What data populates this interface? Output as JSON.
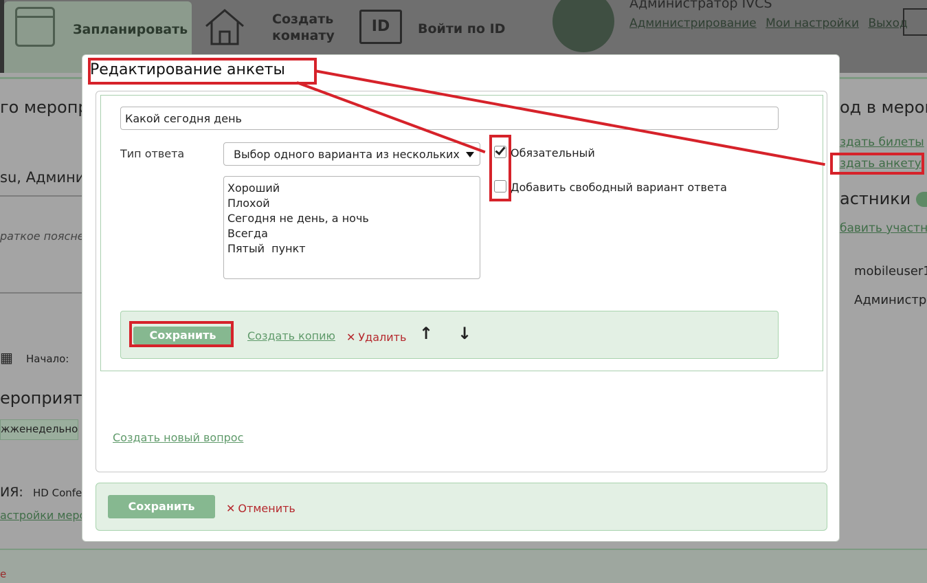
{
  "background": {
    "nav": {
      "schedule_label": "Запланировать",
      "create_room_label": "Создать комнату",
      "id_box_label": "ID",
      "login_by_id_label": "Войти по ID"
    },
    "user": {
      "name": "Администратор IVCS",
      "link_admin": "Администрирование",
      "link_settings": "Мои настройки",
      "link_logout": "Выход"
    },
    "left": {
      "heading": "го меропр",
      "organizer": "su, Админи",
      "hint": "раткое поясне",
      "start_label": "Начало:",
      "section": "ероприяти",
      "recurrence": "жженедельно",
      "type_label": "ИЯ:",
      "type_value": "HD Confe",
      "settings_link": "астройки меро",
      "bottom_link": "е"
    },
    "right": {
      "heading": "од в мероп",
      "create_tickets": "здать билеты",
      "create_form": "здать анкету",
      "participants": "астники",
      "add_participant": "бавить участн",
      "user1": "mobileuser1",
      "user2": "Администра"
    }
  },
  "modal": {
    "title": "Редактирование анкеты",
    "question_value": "Какой сегодня день",
    "answer_type_label": "Тип ответа",
    "answer_type_value": "Выбор одного варианта из нескольких",
    "options": [
      "Хороший",
      "Плохой",
      "Сегодня не день, а ночь",
      "Всегда",
      "Пятый  пункт"
    ],
    "required_label": "Обязательный",
    "required_checked": true,
    "free_answer_label": "Добавить свободный вариант ответа",
    "free_answer_checked": false,
    "actions": {
      "save": "Сохранить",
      "copy": "Создать копию",
      "delete": "Удалить",
      "up_icon": "arrow-up-icon",
      "down_icon": "arrow-down-icon"
    },
    "new_question_link": "Создать новый вопрос",
    "footer": {
      "save": "Сохранить",
      "cancel": "Отменить"
    }
  },
  "colors": {
    "accent_green": "#86b890",
    "link_green": "#5f9a6a",
    "danger_red": "#b5282d",
    "annotation_red": "#d6222a"
  }
}
